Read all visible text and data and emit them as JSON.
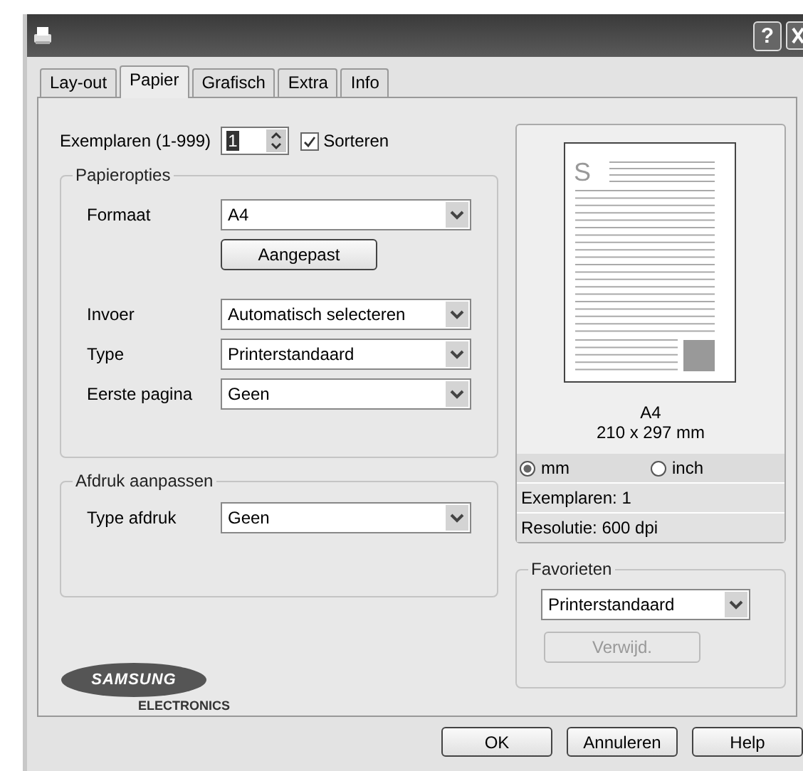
{
  "window": {
    "help_glyph": "?"
  },
  "tabs": [
    {
      "label": "Lay-out",
      "selected": false
    },
    {
      "label": "Papier",
      "selected": true
    },
    {
      "label": "Grafisch",
      "selected": false
    },
    {
      "label": "Extra",
      "selected": false
    },
    {
      "label": "Info",
      "selected": false
    }
  ],
  "copies": {
    "label": "Exemplaren (1-999)",
    "value": "1",
    "collate": {
      "label": "Sorteren",
      "checked": true
    }
  },
  "paper_options": {
    "title": "Papieropties",
    "rows": [
      {
        "kind": "select",
        "label": "Formaat",
        "value": "A4"
      },
      {
        "kind": "button",
        "label": "Aangepast"
      },
      {
        "kind": "select",
        "label": "Invoer",
        "value": "Automatisch selecteren"
      },
      {
        "kind": "select",
        "label": "Type",
        "value": "Printerstandaard"
      },
      {
        "kind": "select",
        "label": "Eerste pagina",
        "value": "Geen"
      }
    ]
  },
  "print_adjust": {
    "title": "Afdruk aanpassen",
    "rows": [
      {
        "kind": "select",
        "label": "Type afdruk",
        "value": "Geen"
      }
    ]
  },
  "logo": {
    "brand": "SAMSUNG",
    "sub": "ELECTRONICS"
  },
  "preview": {
    "page_letter": "S",
    "paper": "A4",
    "size": "210 x 297 mm",
    "units": [
      {
        "label": "mm",
        "selected": true
      },
      {
        "label": "inch",
        "selected": false
      }
    ],
    "info": [
      "Exemplaren: 1",
      "Resolutie: 600 dpi"
    ]
  },
  "favorites": {
    "title": "Favorieten",
    "value": "Printerstandaard",
    "delete_button": {
      "label": "Verwijd.",
      "disabled": true
    }
  },
  "buttons": [
    "OK",
    "Annuleren",
    "Help"
  ]
}
